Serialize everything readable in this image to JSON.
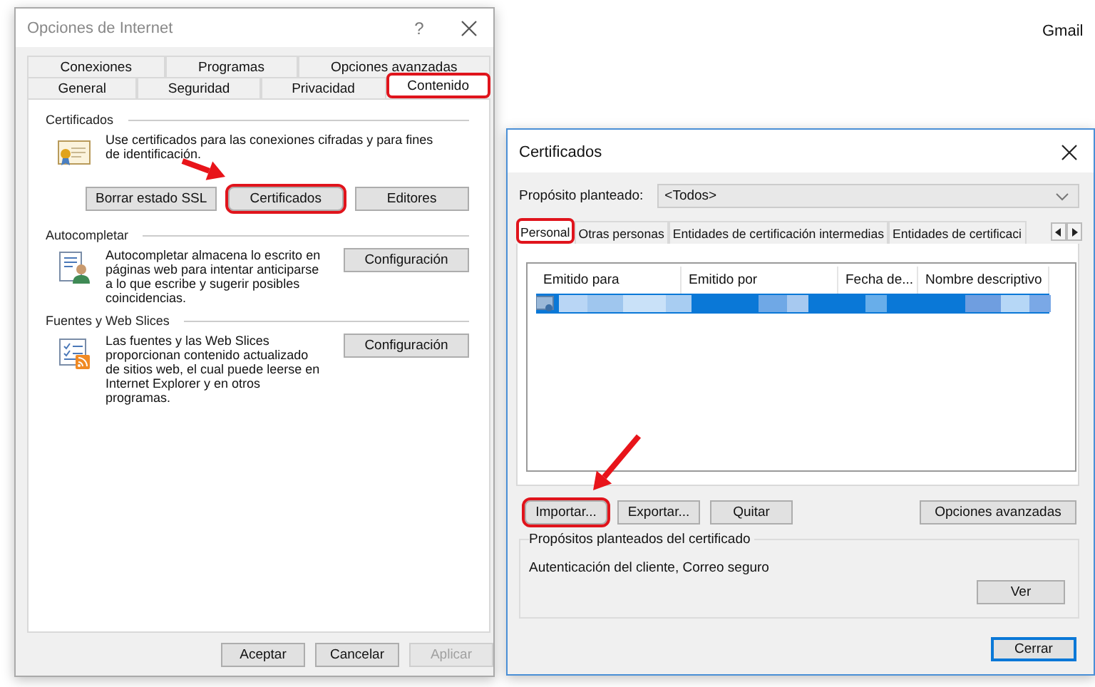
{
  "background_text": "Gmail",
  "internet_options": {
    "title": "Opciones de Internet",
    "help": "?",
    "tab_rows": [
      [
        {
          "label": "Conexiones",
          "selected": false,
          "highlighted": false
        },
        {
          "label": "Programas",
          "selected": false,
          "highlighted": false
        },
        {
          "label": "Opciones avanzadas",
          "selected": false,
          "highlighted": false
        }
      ],
      [
        {
          "label": "General",
          "selected": false,
          "highlighted": false
        },
        {
          "label": "Seguridad",
          "selected": false,
          "highlighted": false
        },
        {
          "label": "Privacidad",
          "selected": false,
          "highlighted": false
        },
        {
          "label": "Contenido",
          "selected": true,
          "highlighted": true
        }
      ]
    ],
    "sections": [
      {
        "kind": "certificate",
        "title": "Certificados",
        "text": "Use certificados para las conexiones cifradas y para fines de identificación.",
        "buttons": [
          {
            "label": "Borrar estado SSL",
            "highlighted": false
          },
          {
            "label": "Certificados",
            "highlighted": true
          },
          {
            "label": "Editores",
            "highlighted": false
          }
        ]
      },
      {
        "kind": "autocomplete",
        "title": "Autocompletar",
        "text": "Autocompletar almacena lo escrito en páginas web para intentar anticiparse a lo que escribe y sugerir posibles coincidencias.",
        "buttons": [
          {
            "label": "Configuración",
            "highlighted": false
          }
        ]
      },
      {
        "kind": "feeds",
        "title": "Fuentes y Web Slices",
        "text": "Las fuentes y las Web Slices proporcionan contenido actualizado de sitios web, el cual puede leerse en Internet Explorer y en otros programas.",
        "buttons": [
          {
            "label": "Configuración",
            "highlighted": false
          }
        ]
      }
    ],
    "footer_buttons": [
      {
        "label": "Aceptar",
        "disabled": false
      },
      {
        "label": "Cancelar",
        "disabled": false
      },
      {
        "label": "Aplicar",
        "disabled": true
      }
    ]
  },
  "certificates": {
    "title": "Certificados",
    "purpose_label": "Propósito planteado:",
    "purpose_value": "<Todos>",
    "tabs": [
      {
        "label": "Personal",
        "selected": true,
        "highlighted": true
      },
      {
        "label": "Otras personas",
        "selected": false,
        "highlighted": false
      },
      {
        "label": "Entidades de certificación intermedias",
        "selected": false,
        "highlighted": false
      },
      {
        "label": "Entidades de certificaci",
        "selected": false,
        "highlighted": false
      }
    ],
    "columns": [
      "Emitido para",
      "Emitido por",
      "Fecha de...",
      "Nombre descriptivo"
    ],
    "rows": [
      {
        "selected": true
      }
    ],
    "buttons": [
      {
        "label": "Importar...",
        "highlighted": true
      },
      {
        "label": "Exportar...",
        "highlighted": false
      },
      {
        "label": "Quitar",
        "highlighted": false
      }
    ],
    "advanced_button": "Opciones avanzadas",
    "group_title": "Propósitos planteados del certificado",
    "group_text": "Autenticación del cliente, Correo seguro",
    "view_button": "Ver",
    "close_button": "Cerrar"
  }
}
